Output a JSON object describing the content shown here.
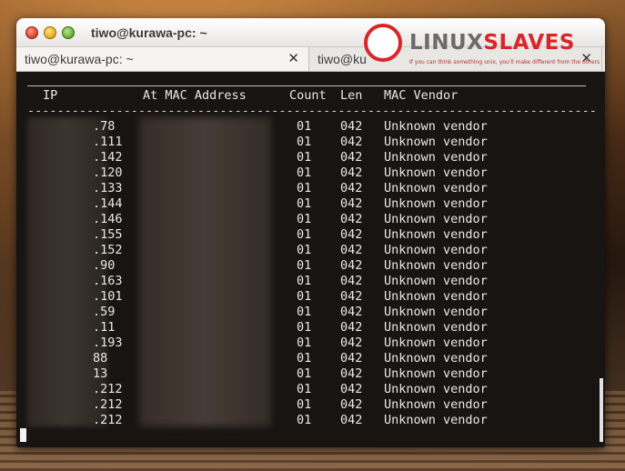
{
  "window": {
    "title": "tiwo@kurawa-pc: ~"
  },
  "tabs": [
    {
      "label": "tiwo@kurawa-pc: ~",
      "close": "✕",
      "active": true
    },
    {
      "label": "tiwo@ku",
      "close": "✕",
      "active": false
    }
  ],
  "logo": {
    "text_linux": "LINUX",
    "text_slaves": "SLAVES",
    "tagline": "If you can think something unix, you'll make different from the others",
    "brand_color": "#d8262b"
  },
  "terminal": {
    "headers": {
      "ip": "IP",
      "mac": "At MAC Address",
      "count": "Count",
      "len": "Len",
      "vendor": "MAC Vendor"
    },
    "separator": "-----------------------------------------------------------------------------",
    "rows": [
      {
        "ip": ".78",
        "count": "01",
        "len": "042",
        "vendor": "Unknown vendor"
      },
      {
        "ip": ".111",
        "count": "01",
        "len": "042",
        "vendor": "Unknown vendor"
      },
      {
        "ip": ".142",
        "count": "01",
        "len": "042",
        "vendor": "Unknown vendor"
      },
      {
        "ip": ".120",
        "count": "01",
        "len": "042",
        "vendor": "Unknown vendor"
      },
      {
        "ip": ".133",
        "count": "01",
        "len": "042",
        "vendor": "Unknown vendor"
      },
      {
        "ip": ".144",
        "count": "01",
        "len": "042",
        "vendor": "Unknown vendor"
      },
      {
        "ip": ".146",
        "count": "01",
        "len": "042",
        "vendor": "Unknown vendor"
      },
      {
        "ip": ".155",
        "count": "01",
        "len": "042",
        "vendor": "Unknown vendor"
      },
      {
        "ip": ".152",
        "count": "01",
        "len": "042",
        "vendor": "Unknown vendor"
      },
      {
        "ip": ".90",
        "count": "01",
        "len": "042",
        "vendor": "Unknown vendor"
      },
      {
        "ip": ".163",
        "count": "01",
        "len": "042",
        "vendor": "Unknown vendor"
      },
      {
        "ip": ".101",
        "count": "01",
        "len": "042",
        "vendor": "Unknown vendor"
      },
      {
        "ip": ".59",
        "count": "01",
        "len": "042",
        "vendor": "Unknown vendor"
      },
      {
        "ip": ".11",
        "count": "01",
        "len": "042",
        "vendor": "Unknown vendor"
      },
      {
        "ip": ".193",
        "count": "01",
        "len": "042",
        "vendor": "Unknown vendor"
      },
      {
        "ip": "88",
        "count": "01",
        "len": "042",
        "vendor": "Unknown vendor"
      },
      {
        "ip": "13",
        "count": "01",
        "len": "042",
        "vendor": "Unknown vendor"
      },
      {
        "ip": ".212",
        "count": "01",
        "len": "042",
        "vendor": "Unknown vendor"
      },
      {
        "ip": ".212",
        "count": "01",
        "len": "042",
        "vendor": "Unknown vendor"
      },
      {
        "ip": ".212",
        "count": "01",
        "len": "042",
        "vendor": "Unknown vendor"
      }
    ]
  }
}
